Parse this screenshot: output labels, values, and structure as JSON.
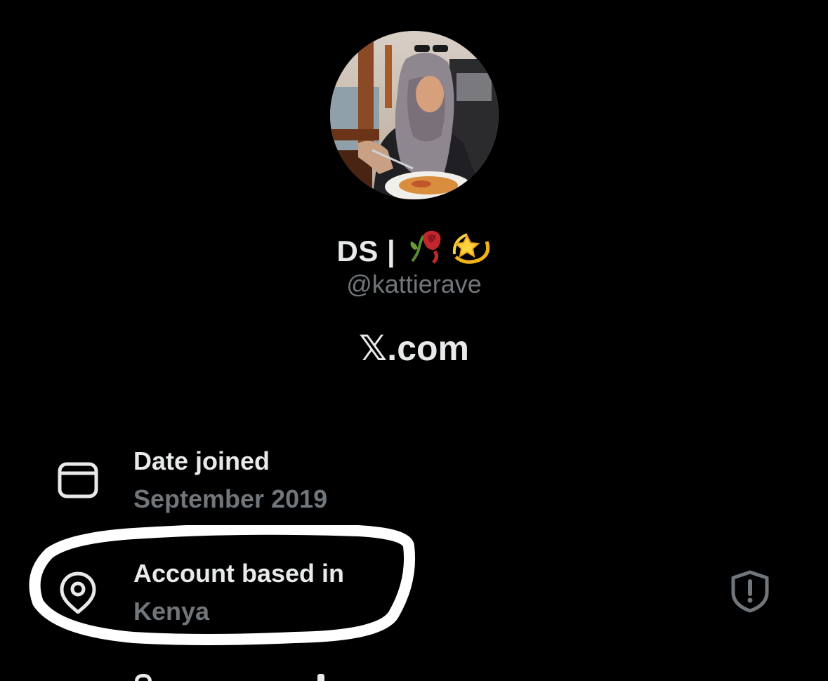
{
  "profile": {
    "display_name": "DS |",
    "display_emojis": [
      "wilted-rose-emoji",
      "dizzy-emoji"
    ],
    "handle": "@kattierave",
    "site_text": ".com",
    "site_logo": "𝕏"
  },
  "details": {
    "date_joined": {
      "icon": "calendar-icon",
      "label": "Date joined",
      "value": "September 2019"
    },
    "account_based": {
      "icon": "location-pin-icon",
      "label": "Account based in",
      "value": "Kenya",
      "trailing_icon": "shield-alert-icon"
    }
  },
  "colors": {
    "background": "#000000",
    "primary_text": "#e7e9ea",
    "secondary_text": "#71767b",
    "annotation": "#ffffff"
  }
}
